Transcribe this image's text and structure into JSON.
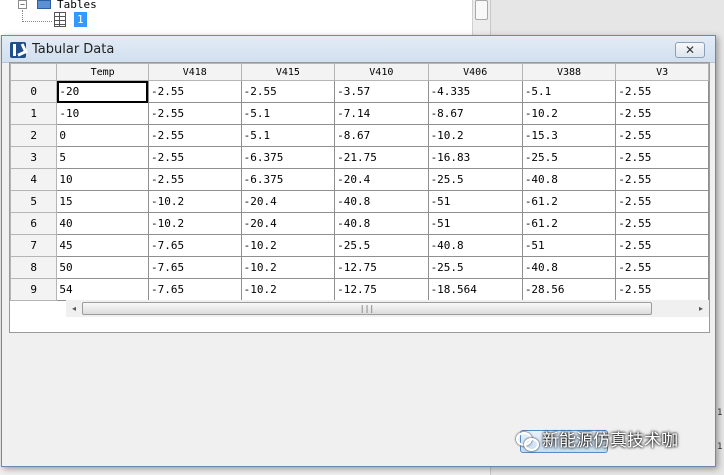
{
  "tree": {
    "expander": "−",
    "folder_label": "Tables",
    "selected_item": "1"
  },
  "dialog": {
    "title": "Tabular Data",
    "close_glyph": "✕"
  },
  "grid": {
    "columns": [
      "Temp",
      "V418",
      "V415",
      "V410",
      "V406",
      "V388",
      "V3"
    ],
    "rows": [
      {
        "index": "0",
        "cells": [
          "-20",
          "-2.55",
          "-2.55",
          "-3.57",
          "-4.335",
          "-5.1",
          "-2.55"
        ]
      },
      {
        "index": "1",
        "cells": [
          "-10",
          "-2.55",
          "-5.1",
          "-7.14",
          "-8.67",
          "-10.2",
          "-2.55"
        ]
      },
      {
        "index": "2",
        "cells": [
          "0",
          "-2.55",
          "-5.1",
          "-8.67",
          "-10.2",
          "-15.3",
          "-2.55"
        ]
      },
      {
        "index": "3",
        "cells": [
          "5",
          "-2.55",
          "-6.375",
          "-21.75",
          "-16.83",
          "-25.5",
          "-2.55"
        ]
      },
      {
        "index": "4",
        "cells": [
          "10",
          "-2.55",
          "-6.375",
          "-20.4",
          "-25.5",
          "-40.8",
          "-2.55"
        ]
      },
      {
        "index": "5",
        "cells": [
          "15",
          "-10.2",
          "-20.4",
          "-40.8",
          "-51",
          "-61.2",
          "-2.55"
        ]
      },
      {
        "index": "6",
        "cells": [
          "40",
          "-10.2",
          "-20.4",
          "-40.8",
          "-51",
          "-61.2",
          "-2.55"
        ]
      },
      {
        "index": "7",
        "cells": [
          "45",
          "-7.65",
          "-10.2",
          "-25.5",
          "-40.8",
          "-51",
          "-2.55"
        ]
      },
      {
        "index": "8",
        "cells": [
          "50",
          "-7.65",
          "-10.2",
          "-12.75",
          "-25.5",
          "-40.8",
          "-2.55"
        ]
      },
      {
        "index": "9",
        "cells": [
          "54",
          "-7.65",
          "-10.2",
          "-12.75",
          "-18.564",
          "-28.56",
          "-2.55"
        ]
      }
    ]
  },
  "scrollbar": {
    "left_arrow": "◂",
    "right_arrow": "▸",
    "grip": "|||"
  },
  "right_pane": {
    "marks": [
      "1",
      "1"
    ]
  },
  "watermark": {
    "text": "新能源仿真技术咖"
  }
}
